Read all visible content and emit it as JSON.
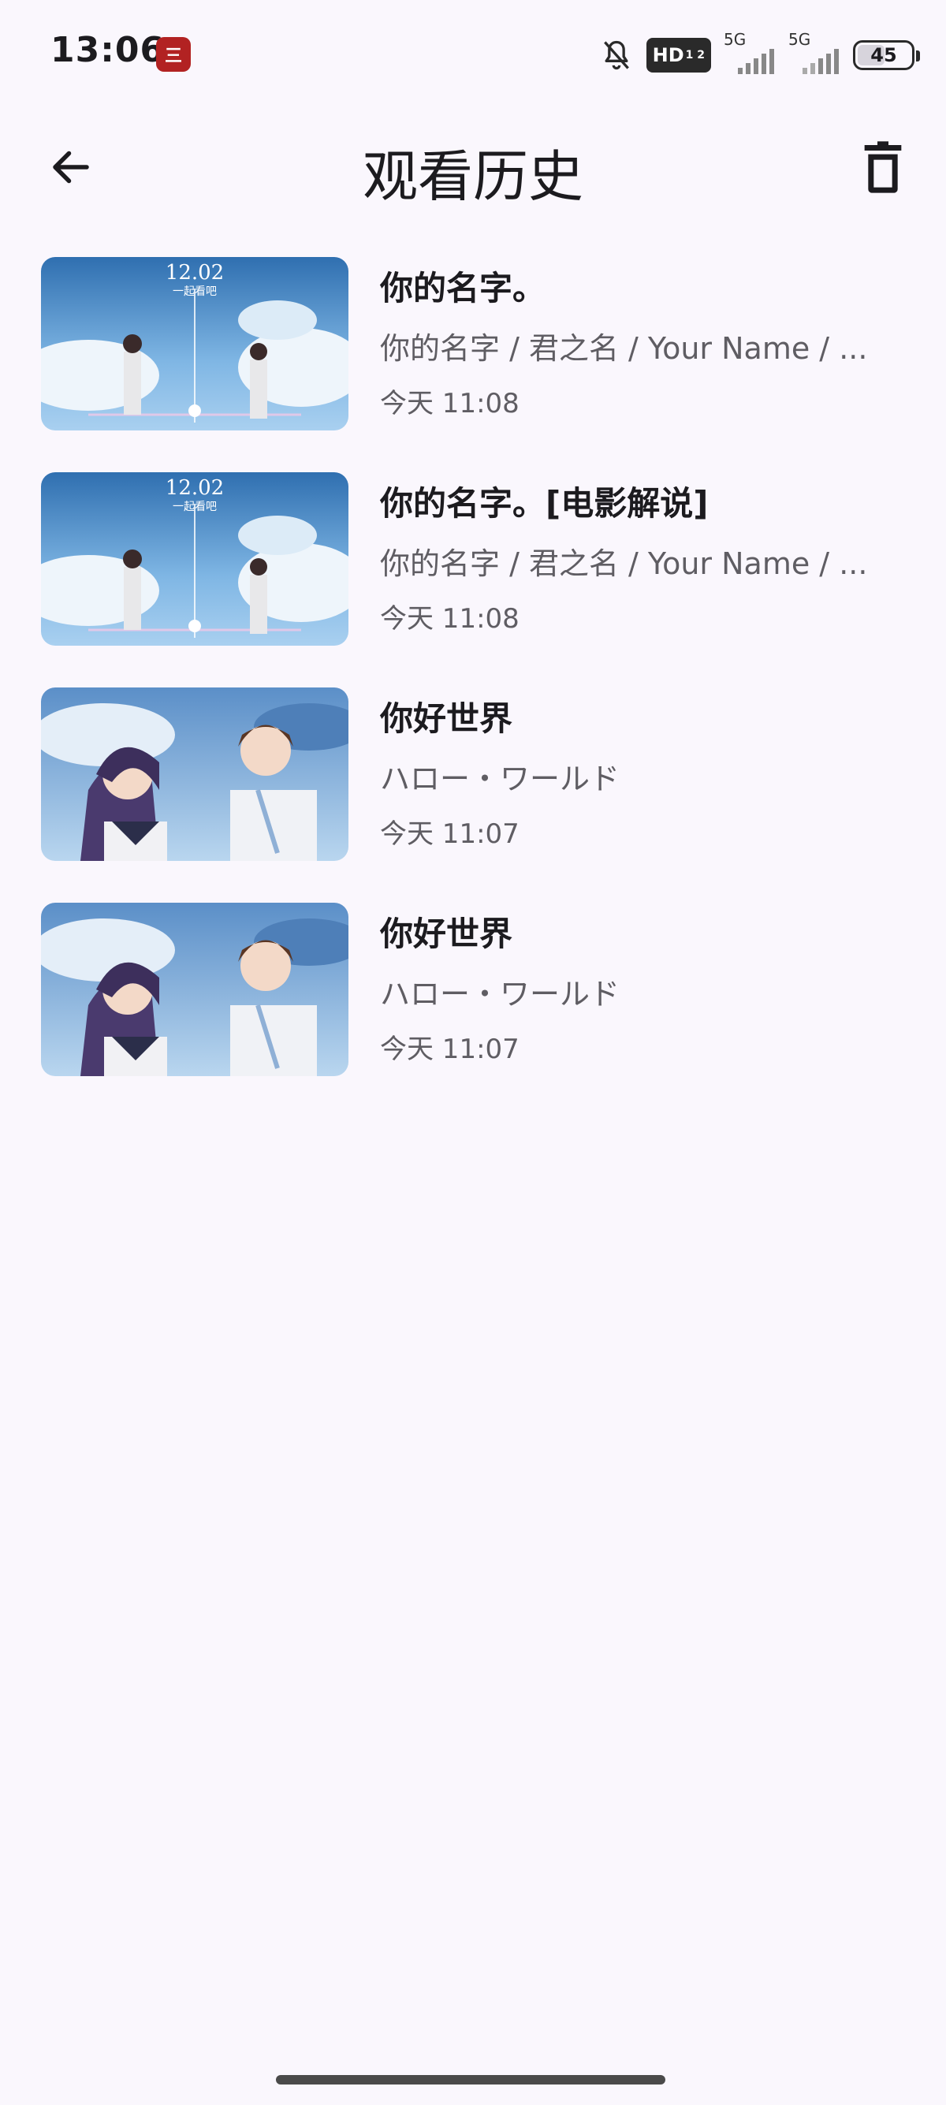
{
  "status_bar": {
    "time": "13:06",
    "app_badge": "三",
    "hd_label": "HD",
    "hd_sub": "1 2",
    "sim1_label": "5G",
    "sim2_label": "5G",
    "battery": "45",
    "icons": [
      "bell-muted-icon",
      "hd-icon",
      "signal-icon",
      "signal-icon",
      "battery-icon"
    ]
  },
  "app_bar": {
    "title": "观看历史",
    "back_icon": "arrow-left-icon",
    "delete_icon": "trash-icon"
  },
  "history": [
    {
      "title": "你的名字。",
      "subtitle": "你的名字 / 君之名 / Your Name / ...",
      "time": "今天 11:08",
      "poster_caption": "12.02",
      "poster_sub": "一起看吧",
      "poster": "your-name-poster"
    },
    {
      "title": "你的名字。[电影解说]",
      "subtitle": "你的名字 / 君之名 / Your Name / ...",
      "time": "今天 11:08",
      "poster_caption": "12.02",
      "poster_sub": "一起看吧",
      "poster": "your-name-poster"
    },
    {
      "title": "你好世界",
      "subtitle": "ハロー・ワールド",
      "time": "今天 11:07",
      "poster": "hello-world-poster"
    },
    {
      "title": "你好世界",
      "subtitle": "ハロー・ワールド",
      "time": "今天 11:07",
      "poster": "hello-world-poster"
    }
  ]
}
